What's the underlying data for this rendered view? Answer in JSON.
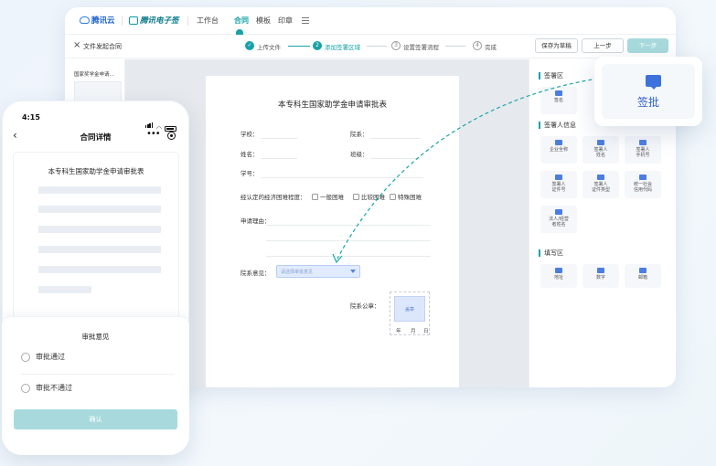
{
  "topbar": {
    "brand_tencent_cloud": "腾讯云",
    "brand_esign": "腾讯电子签",
    "nav": [
      "工作台",
      "合同",
      "模板",
      "印章"
    ]
  },
  "toolbar": {
    "title": "文件发起合同",
    "steps": [
      {
        "num": "✓",
        "label": "上传文件"
      },
      {
        "num": "2",
        "label": "添加签署区域"
      },
      {
        "num": "3",
        "label": "设置签署流程"
      },
      {
        "num": "4",
        "label": "完成"
      }
    ],
    "save_draft": "保存为草稿",
    "prev": "上一步",
    "next": "下一步"
  },
  "thumbs": {
    "title": "国家奖学金申请…",
    "tag": "审批意见"
  },
  "document": {
    "title": "本专科生国家助学金申请审批表",
    "school": "学校：",
    "dept": "院系：",
    "name": "姓名：",
    "class": "班级：",
    "student_id": "学号：",
    "difficulty": "经认定的经济困难程度：",
    "general": "一般困难",
    "severe": "比较困难",
    "special": "特殊困难",
    "reason": "申请理由：",
    "opinion": "院系意见：",
    "dropdown_placeholder": "请选择审批意见",
    "seal": "院系公章：",
    "seal_btn": "盖章",
    "date_y": "年",
    "date_m": "月",
    "date_d": "日"
  },
  "right_panel": {
    "sign_area": "签署区",
    "sign_tile": "签名",
    "signer_info": "签署人信息",
    "signer_tiles": [
      [
        "企业全称"
      ],
      [
        "签署人",
        "姓名"
      ],
      [
        "签署人",
        "手机号"
      ],
      [
        "签署人",
        "证件号"
      ],
      [
        "签署人",
        "证件类型"
      ],
      [
        "统一社会",
        "信用代码"
      ],
      [
        "法人/经营",
        "者姓名"
      ]
    ],
    "fill_area": "填写区",
    "fill_tiles": [
      "地址",
      "数字",
      "邮箱"
    ]
  },
  "callout": {
    "label": "签批"
  },
  "phone": {
    "time": "4:15",
    "title": "合同详情",
    "doc_title": "本专科生国家助学金申请审批表",
    "sheet_title": "审批意见",
    "approve": "审批通过",
    "reject": "审批不通过",
    "confirm": "确认"
  },
  "colors": {
    "accent": "#17a2a8",
    "accent_light": "#a8dadd",
    "blue": "#3d72dd",
    "dashed_arrow": "#1aa8a8"
  }
}
